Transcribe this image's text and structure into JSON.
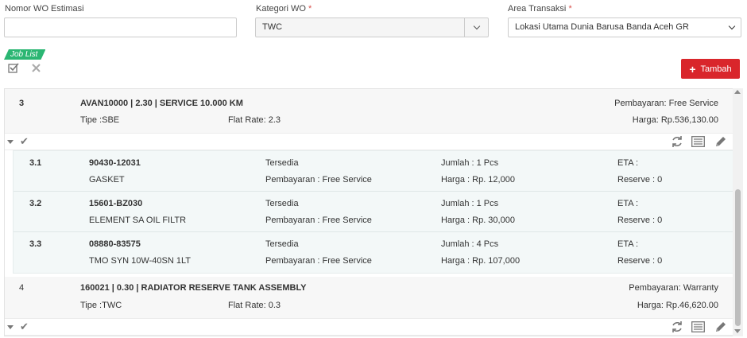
{
  "form": {
    "wo_number": {
      "label": "Nomor WO Estimasi",
      "value": ""
    },
    "wo_category": {
      "label": "Kategori WO",
      "required": "*",
      "value": "TWC"
    },
    "transaction_area": {
      "label": "Area Transaksi",
      "required": "*",
      "value": "Lokasi Utama Dunia Barusa Banda Aceh GR"
    }
  },
  "toolbar": {
    "job_list_label": "Job List",
    "check_icon": "check-square-icon",
    "cancel_icon": "close-icon",
    "add_label": "Tambah",
    "add_icon": "+"
  },
  "colors": {
    "accent_green": "#2bb673",
    "add_red": "#d9262b"
  },
  "jobs": [
    {
      "no": "3",
      "title": "AVAN10000 | 2.30 | SERVICE 10.000 KM",
      "type": "Tipe :SBE",
      "flat_rate": "Flat Rate: 2.3",
      "payment": "Pembayaran: Free Service",
      "price": "Harga: Rp.536,130.00",
      "parts": [
        {
          "no": "3.1",
          "code": "90430-12031",
          "name": "GASKET",
          "status": "Tersedia",
          "payment": "Pembayaran : Free Service",
          "qty": "Jumlah : 1 Pcs",
          "price": "Harga : Rp. 12,000",
          "eta": "ETA :",
          "reserve": "Reserve : 0"
        },
        {
          "no": "3.2",
          "code": "15601-BZ030",
          "name": "ELEMENT SA OIL FILTR",
          "status": "Tersedia",
          "payment": "Pembayaran : Free Service",
          "qty": "Jumlah : 1 Pcs",
          "price": "Harga : Rp. 30,000",
          "eta": "ETA :",
          "reserve": "Reserve : 0"
        },
        {
          "no": "3.3",
          "code": "08880-83575",
          "name": "TMO SYN 10W-40SN 1LT",
          "status": "Tersedia",
          "payment": "Pembayaran : Free Service",
          "qty": "Jumlah : 4 Pcs",
          "price": "Harga : Rp. 107,000",
          "eta": "ETA :",
          "reserve": "Reserve : 0"
        }
      ]
    },
    {
      "no": "4",
      "title": "160021 | 0.30 | RADIATOR RESERVE TANK ASSEMBLY",
      "type": "Tipe :TWC",
      "flat_rate": "Flat Rate: 0.3",
      "payment": "Pembayaran: Warranty",
      "price": "Harga: Rp.46,620.00"
    }
  ]
}
